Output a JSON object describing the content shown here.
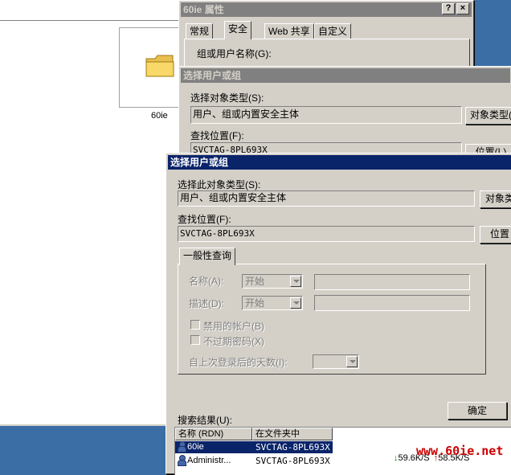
{
  "explorer": {
    "folder_label": "60ie"
  },
  "props_dialog": {
    "title": "60ie 属性",
    "help_btn": "?",
    "close_btn": "×",
    "tabs": [
      "常规",
      "安全",
      "Web 共享",
      "自定义"
    ],
    "group_label": "组或用户名称(G):"
  },
  "select_dialog_back": {
    "title": "选择用户或组",
    "obj_type_label": "选择对象类型(S):",
    "obj_type_value": "用户、组或内置安全主体",
    "obj_type_button": "对象类型(",
    "location_label": "查找位置(F):",
    "location_value": "SVCTAG-8PL693X",
    "location_button": "位置(L)"
  },
  "select_dialog_front": {
    "title": "选择用户或组",
    "obj_type_label": "选择此对象类型(S):",
    "obj_type_value": "用户、组或内置安全主体",
    "obj_type_button": "对象类",
    "location_label": "查找位置(F):",
    "location_value": "SVCTAG-8PL693X",
    "location_button": "位置",
    "query_tab": "一般性查询",
    "name_label": "名称(A):",
    "name_combo": "开始",
    "desc_label": "描述(D):",
    "desc_combo": "开始",
    "disabled_accounts": "禁用的帐户(B)",
    "no_expire_pwd": "不过期密码(X)",
    "days_since_logon": "自上次登录后的天数(I):",
    "ok_button": "确定",
    "results_label": "搜索结果(U):",
    "columns": [
      "名称 (RDN)",
      "在文件夹中"
    ],
    "rows": [
      {
        "name": "60ie",
        "folder": "SVCTAG-8PL693X",
        "selected": true
      },
      {
        "name": "Administr...",
        "folder": "SVCTAG-8PL693X",
        "selected": false
      }
    ]
  },
  "overlay": {
    "down_speed": "59.6K/S",
    "up_speed": "58.5K/S",
    "watermark": "www.60ie.net"
  },
  "colors": {
    "desktop": "#3a6ea5",
    "title_active": "#0a246a",
    "face": "#d4d0c8",
    "watermark": "#cc0000"
  }
}
